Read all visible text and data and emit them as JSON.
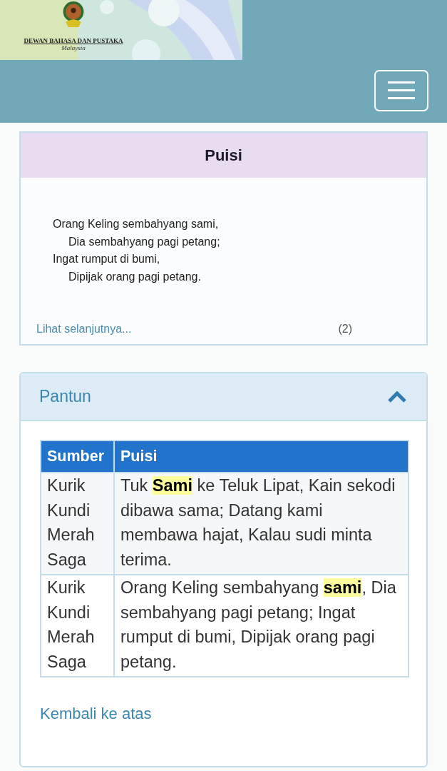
{
  "header": {
    "logo": {
      "name": "DEWAN BAHASA DAN PUSTAKA",
      "country": "Malaysia"
    }
  },
  "puisi_card": {
    "title": "Puisi",
    "lines": [
      {
        "text": "Orang Keling sembahyang sami,",
        "indented": false
      },
      {
        "text": "Dia sembahyang pagi petang;",
        "indented": true
      },
      {
        "text": "Ingat rumput di bumi,",
        "indented": false
      },
      {
        "text": "Dipijak orang pagi petang.",
        "indented": true
      }
    ],
    "more_link": "Lihat selanjutnya...",
    "count": "(2)"
  },
  "pantun_panel": {
    "title": "Pantun",
    "expanded": true,
    "table": {
      "columns": [
        "Sumber",
        "Puisi"
      ],
      "rows": [
        [
          "Kurik Kundi Merah Saga",
          "Tuk **Sami** ke Teluk Lipat, Kain sekodi dibawa sama; Datang kami membawa hajat, Kalau sudi minta terima."
        ],
        [
          "Kurik Kundi Merah Saga",
          "Orang Keling sembahyang **sami**, Dia sembahyang pagi petang; Ingat rumput di bumi, Dipijak orang pagi petang."
        ]
      ]
    },
    "back_link": "Kembali ke atas"
  }
}
